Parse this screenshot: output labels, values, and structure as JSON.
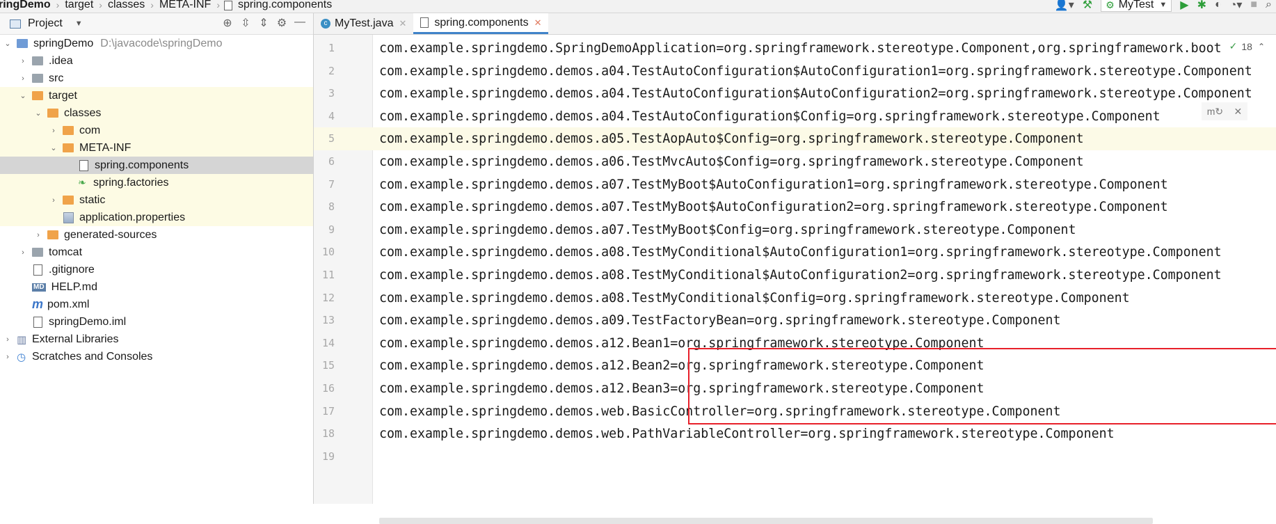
{
  "breadcrumb": {
    "items": [
      "ringDemo",
      "target",
      "classes",
      "META-INF",
      "spring.components"
    ]
  },
  "toolbar": {
    "run_config": "MyTest"
  },
  "project_panel": {
    "title": "Project",
    "tree": [
      {
        "label": "springDemo",
        "sub": "D:\\javacode\\springDemo",
        "icon": "module-folder-icon",
        "level": 0,
        "expand": "open"
      },
      {
        "label": ".idea",
        "icon": "folder-icon",
        "level": 1,
        "expand": "closed"
      },
      {
        "label": "src",
        "icon": "folder-icon",
        "level": 1,
        "expand": "closed"
      },
      {
        "label": "target",
        "icon": "excluded-folder-icon",
        "level": 1,
        "expand": "open"
      },
      {
        "label": "classes",
        "icon": "excluded-folder-icon",
        "level": 2,
        "expand": "open"
      },
      {
        "label": "com",
        "icon": "excluded-folder-icon",
        "level": 3,
        "expand": "closed"
      },
      {
        "label": "META-INF",
        "icon": "excluded-folder-icon",
        "level": 3,
        "expand": "open"
      },
      {
        "label": "spring.components",
        "icon": "file-icon",
        "level": 4,
        "expand": "none",
        "selected": true
      },
      {
        "label": "spring.factories",
        "icon": "spring-leaf-icon",
        "level": 4,
        "expand": "none"
      },
      {
        "label": "static",
        "icon": "excluded-folder-icon",
        "level": 3,
        "expand": "closed"
      },
      {
        "label": "application.properties",
        "icon": "properties-file-icon",
        "level": 3,
        "expand": "none"
      },
      {
        "label": "generated-sources",
        "icon": "excluded-folder-icon",
        "level": 2,
        "expand": "closed"
      },
      {
        "label": "tomcat",
        "icon": "folder-icon",
        "level": 1,
        "expand": "closed"
      },
      {
        "label": ".gitignore",
        "icon": "gitignore-file-icon",
        "level": 1,
        "expand": "none"
      },
      {
        "label": "HELP.md",
        "icon": "markdown-file-icon",
        "level": 1,
        "expand": "none"
      },
      {
        "label": "pom.xml",
        "icon": "maven-file-icon",
        "level": 1,
        "expand": "none"
      },
      {
        "label": "springDemo.iml",
        "icon": "iml-file-icon",
        "level": 1,
        "expand": "none"
      },
      {
        "label": "External Libraries",
        "icon": "libraries-icon",
        "level": 0,
        "expand": "closed"
      },
      {
        "label": "Scratches and Consoles",
        "icon": "scratches-icon",
        "level": 0,
        "expand": "closed"
      }
    ]
  },
  "editor": {
    "tabs": [
      {
        "label": "MyTest.java",
        "active": false
      },
      {
        "label": "spring.components",
        "active": true
      }
    ],
    "inspection_count": "18",
    "current_line": 5,
    "highlighted_lines": [
      14,
      15,
      16
    ],
    "lines": [
      "com.example.springdemo.SpringDemoApplication=org.springframework.stereotype.Component,org.springframework.boot",
      "com.example.springdemo.demos.a04.TestAutoConfiguration$AutoConfiguration1=org.springframework.stereotype.Component",
      "com.example.springdemo.demos.a04.TestAutoConfiguration$AutoConfiguration2=org.springframework.stereotype.Component",
      "com.example.springdemo.demos.a04.TestAutoConfiguration$Config=org.springframework.stereotype.Component",
      "com.example.springdemo.demos.a05.TestAopAuto$Config=org.springframework.stereotype.Component",
      "com.example.springdemo.demos.a06.TestMvcAuto$Config=org.springframework.stereotype.Component",
      "com.example.springdemo.demos.a07.TestMyBoot$AutoConfiguration1=org.springframework.stereotype.Component",
      "com.example.springdemo.demos.a07.TestMyBoot$AutoConfiguration2=org.springframework.stereotype.Component",
      "com.example.springdemo.demos.a07.TestMyBoot$Config=org.springframework.stereotype.Component",
      "com.example.springdemo.demos.a08.TestMyConditional$AutoConfiguration1=org.springframework.stereotype.Component",
      "com.example.springdemo.demos.a08.TestMyConditional$AutoConfiguration2=org.springframework.stereotype.Component",
      "com.example.springdemo.demos.a08.TestMyConditional$Config=org.springframework.stereotype.Component",
      "com.example.springdemo.demos.a09.TestFactoryBean=org.springframework.stereotype.Component",
      "com.example.springdemo.demos.a12.Bean1=org.springframework.stereotype.Component",
      "com.example.springdemo.demos.a12.Bean2=org.springframework.stereotype.Component",
      "com.example.springdemo.demos.a12.Bean3=org.springframework.stereotype.Component",
      "com.example.springdemo.demos.web.BasicController=org.springframework.stereotype.Component",
      "com.example.springdemo.demos.web.PathVariableController=org.springframework.stereotype.Component",
      ""
    ]
  }
}
